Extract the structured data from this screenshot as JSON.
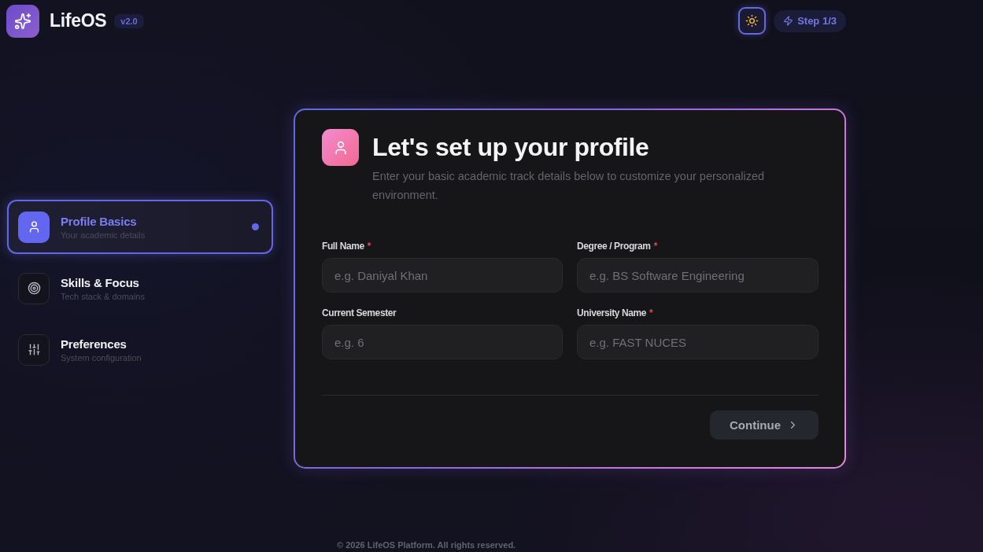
{
  "app": {
    "name": "LifeOS",
    "version": "v2.0"
  },
  "header": {
    "step": "Step 1/3"
  },
  "steps": [
    {
      "title": "Profile Basics",
      "subtitle": "Your academic details",
      "selected": true
    },
    {
      "title": "Skills & Focus",
      "subtitle": "Tech stack & domains",
      "selected": false
    },
    {
      "title": "Preferences",
      "subtitle": "System configuration",
      "selected": false
    }
  ],
  "card": {
    "title": "Let's set up your profile",
    "subtitle": "Enter your basic academic track details below to customize your personalized environment.",
    "fields": [
      {
        "label": "Full Name",
        "required_mark": "*",
        "placeholder": "e.g. Daniyal Khan"
      },
      {
        "label": "Degree / Program",
        "required_mark": "*",
        "placeholder": "e.g. BS Software Engineering"
      },
      {
        "label": "Current Semester",
        "placeholder": "e.g. 6"
      },
      {
        "label": "University Name",
        "required_mark": "*",
        "placeholder": "e.g. FAST NUCES"
      }
    ],
    "continue_button": {
      "label": "Continue",
      "disabled": true
    }
  },
  "footer": "© 2026 LifeOS Platform. All rights reserved."
}
